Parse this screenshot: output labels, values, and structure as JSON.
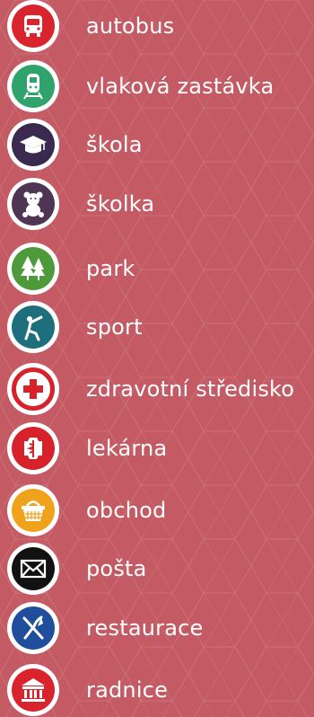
{
  "legend": {
    "items": [
      {
        "label": "autobus",
        "icon": "bus-icon",
        "color": "#d9232d"
      },
      {
        "label": "vlaková zastávka",
        "icon": "train-icon",
        "color": "#2fa36b"
      },
      {
        "label": "škola",
        "icon": "graduation-cap-icon",
        "color": "#3b2a4f"
      },
      {
        "label": "školka",
        "icon": "teddy-bear-icon",
        "color": "#4d3553"
      },
      {
        "label": "park",
        "icon": "trees-icon",
        "color": "#4e9a3a"
      },
      {
        "label": "sport",
        "icon": "stretching-person-icon",
        "color": "#1e6f7d"
      },
      {
        "label": "zdravotní středisko",
        "icon": "medical-cross-icon",
        "color": "#d8222b"
      },
      {
        "label": "lekárna",
        "icon": "pharmacy-caduceus-icon",
        "color": "#d8222b"
      },
      {
        "label": "obchod",
        "icon": "shopping-basket-icon",
        "color": "#f1a21b"
      },
      {
        "label": "pošta",
        "icon": "envelope-icon",
        "color": "#111111"
      },
      {
        "label": "restaurace",
        "icon": "fork-knife-icon",
        "color": "#1f4f9c"
      },
      {
        "label": "radnice",
        "icon": "town-hall-icon",
        "color": "#d9232d"
      }
    ]
  }
}
